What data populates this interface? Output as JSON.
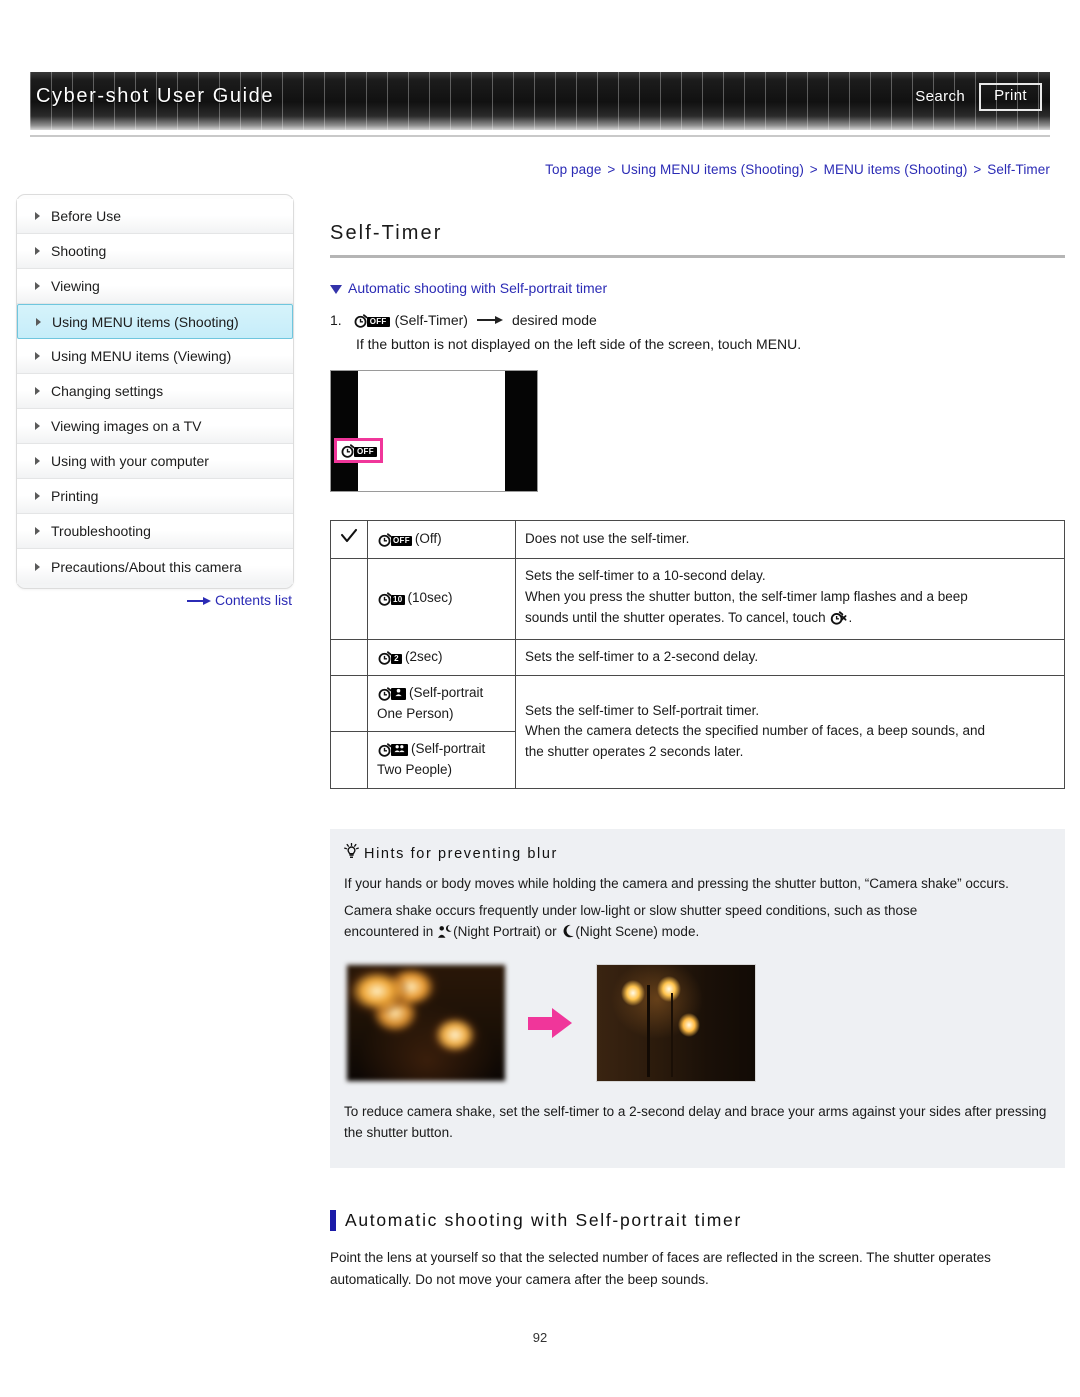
{
  "header": {
    "title": "Cyber-shot User Guide",
    "search_label": "Search",
    "print_label": "Print"
  },
  "breadcrumb": {
    "items": [
      "Top page",
      "Using MENU items (Shooting)",
      "MENU items (Shooting)",
      "Self-Timer"
    ],
    "separator": ">"
  },
  "sidebar": {
    "items": [
      {
        "label": "Before Use",
        "active": false
      },
      {
        "label": "Shooting",
        "active": false
      },
      {
        "label": "Viewing",
        "active": false
      },
      {
        "label": "Using MENU items (Shooting)",
        "active": true
      },
      {
        "label": "Using MENU items (Viewing)",
        "active": false
      },
      {
        "label": "Changing settings",
        "active": false
      },
      {
        "label": "Viewing images on a TV",
        "active": false
      },
      {
        "label": "Using with your computer",
        "active": false
      },
      {
        "label": "Printing",
        "active": false
      },
      {
        "label": "Troubleshooting",
        "active": false
      },
      {
        "label": "Precautions/About this camera",
        "active": false
      }
    ],
    "contents_link": "Contents list"
  },
  "main": {
    "page_title": "Self-Timer",
    "section_link": "Automatic shooting with Self-portrait timer",
    "step": {
      "number": "1.",
      "icon_badge": "OFF",
      "icon_label": "(Self-Timer)",
      "target": "desired mode",
      "note": "If the button is not displayed on the left side of the screen, touch MENU."
    },
    "lcd_caption_icon_badge": "OFF",
    "table": {
      "rows": [
        {
          "checked": true,
          "icon_badge": "OFF",
          "option": "(Off)",
          "description": "Does not use the self-timer."
        },
        {
          "checked": false,
          "icon_badge": "10",
          "option": "(10sec)",
          "description_lines": [
            "Sets the self-timer to a 10-second delay.",
            "When you press the shutter button, the self-timer lamp flashes and a beep",
            "sounds until the shutter operates. To cancel, touch"
          ],
          "description_tail": "."
        },
        {
          "checked": false,
          "icon_badge": "2",
          "option": "(2sec)",
          "description": "Sets the self-timer to a 2-second delay."
        },
        {
          "checked": false,
          "icon_badge": "person1",
          "option_line1": "(Self-portrait",
          "option_line2": "One Person)",
          "description_lines": [
            "Sets the self-timer to Self-portrait timer.",
            "When the camera detects the specified number of faces, a beep sounds, and",
            "the shutter operates 2 seconds later."
          ]
        },
        {
          "checked": false,
          "icon_badge": "person2",
          "option_line1": "(Self-portrait",
          "option_line2": "Two People)"
        }
      ]
    },
    "hints": {
      "title": "Hints for preventing blur",
      "paragraphs": [
        "If your hands or body moves while holding the camera and pressing the shutter button, “Camera shake” occurs.",
        "Camera shake occurs frequently under low-light or slow shutter speed conditions, such as those"
      ],
      "line_night_prefix": "encountered in",
      "night_portrait_label": "(Night Portrait) or",
      "night_scene_label": "(Night Scene) mode.",
      "closing": "To reduce camera shake, set the self-timer to a 2-second delay and brace your arms against your sides after pressing the shutter button."
    },
    "sub_section": {
      "heading": "Automatic shooting with Self-portrait timer",
      "body": "Point the lens at yourself so that the selected number of faces are reflected in the screen. The shutter operates automatically. Do not move your camera after the beep sounds."
    }
  },
  "footer": {
    "page_number": "92"
  },
  "colors": {
    "link": "#2b2bb5",
    "accent_pink": "#f0369a",
    "sidebar_active_bg": "#c9eff9",
    "hints_bg": "#eef0f3",
    "heading_bar": "#1a1aa8"
  }
}
